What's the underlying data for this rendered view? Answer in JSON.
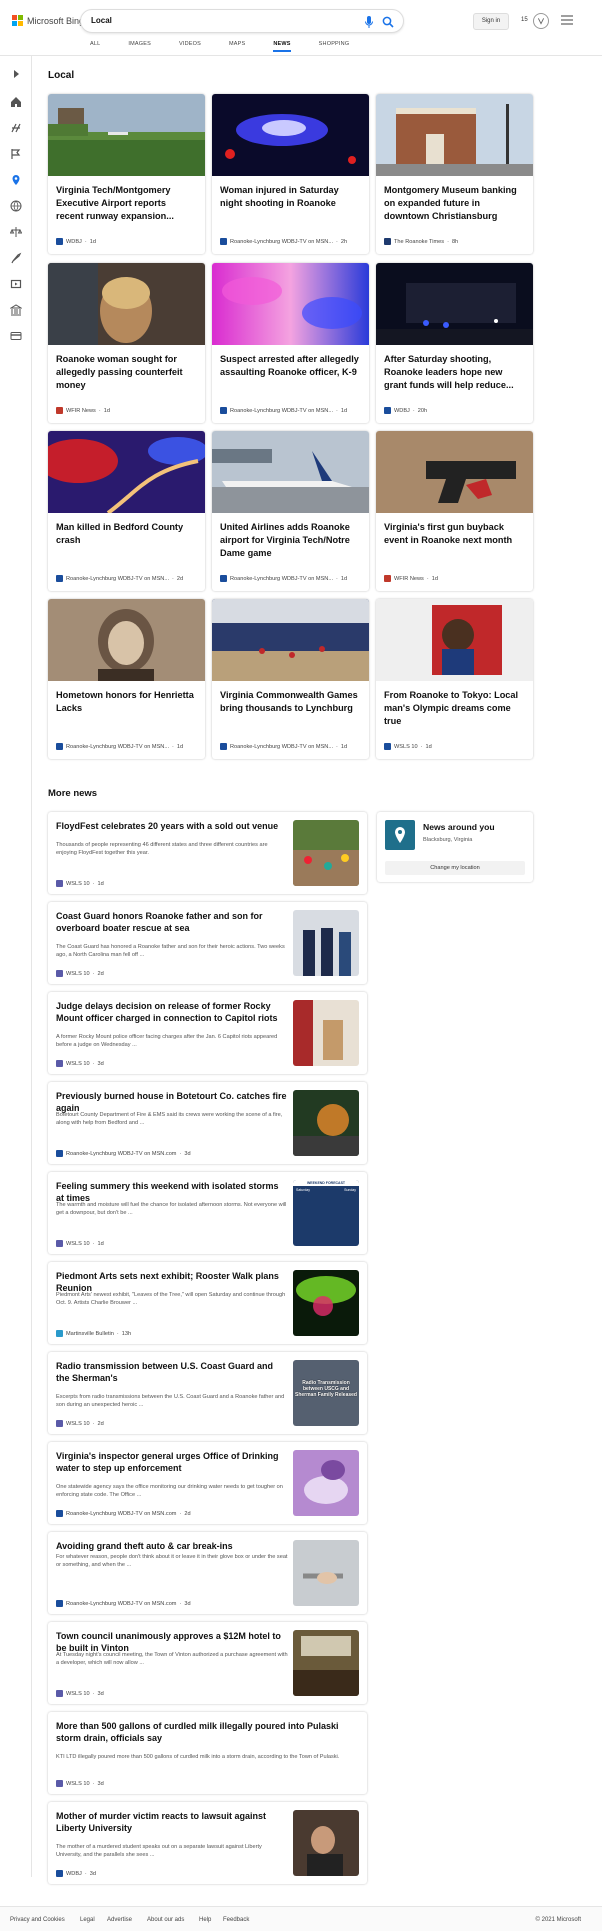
{
  "header": {
    "logo_text": "Microsoft Bing",
    "search_value": "Local",
    "signin_label": "Sign in",
    "points": "15",
    "tabs": [
      "ALL",
      "IMAGES",
      "VIDEOS",
      "MAPS",
      "NEWS",
      "SHOPPING"
    ],
    "active_tab": "NEWS"
  },
  "local": {
    "title": "Local",
    "cards": [
      {
        "title": "Virginia Tech/Montgomery Executive Airport reports recent runway expansion...",
        "source": "WDBJ",
        "time": "1d"
      },
      {
        "title": "Woman injured in Saturday night shooting in Roanoke",
        "source": "Roanoke-Lynchburg WDBJ-TV on MSN...",
        "time": "2h"
      },
      {
        "title": "Montgomery Museum banking on expanded future in downtown Christiansburg",
        "source": "The Roanoke Times",
        "time": "8h"
      },
      {
        "title": "Roanoke woman sought for allegedly passing counterfeit money",
        "source": "WFIR News",
        "time": "1d"
      },
      {
        "title": "Suspect arrested after allegedly assaulting Roanoke officer, K-9",
        "source": "Roanoke-Lynchburg WDBJ-TV on MSN...",
        "time": "1d"
      },
      {
        "title": "After Saturday shooting, Roanoke leaders hope new grant funds will help reduce...",
        "source": "WDBJ",
        "time": "20h"
      },
      {
        "title": "Man killed in Bedford County crash",
        "source": "Roanoke-Lynchburg WDBJ-TV on MSN...",
        "time": "2d"
      },
      {
        "title": "United Airlines adds Roanoke airport for Virginia Tech/Notre Dame game",
        "source": "Roanoke-Lynchburg WDBJ-TV on MSN...",
        "time": "1d"
      },
      {
        "title": "Virginia's first gun buyback event in Roanoke next month",
        "source": "WFIR News",
        "time": "1d"
      },
      {
        "title": "Hometown honors for Henrietta Lacks",
        "source": "Roanoke-Lynchburg WDBJ-TV on MSN...",
        "time": "1d"
      },
      {
        "title": "Virginia Commonwealth Games bring thousands to Lynchburg",
        "source": "Roanoke-Lynchburg WDBJ-TV on MSN...",
        "time": "1d"
      },
      {
        "title": "From Roanoke to Tokyo: Local man's Olympic dreams come true",
        "source": "WSLS 10",
        "time": "1d"
      }
    ]
  },
  "more": {
    "title": "More news",
    "items": [
      {
        "title": "FloydFest celebrates 20 years with a sold out venue",
        "desc": "Thousands of people representing 46 different states and three different countries are enjoying FloydFest together this year.",
        "source": "WSLS 10",
        "time": "1d"
      },
      {
        "title": "Coast Guard honors Roanoke father and son for overboard boater rescue at sea",
        "desc": "The Coast Guard has honored a Roanoke father and son for their heroic actions. Two weeks ago, a North Carolina man fell off ...",
        "source": "WSLS 10",
        "time": "2d"
      },
      {
        "title": "Judge delays decision on release of former Rocky Mount officer charged in connection to Capitol riots",
        "desc": "A former Rocky Mount police officer facing charges after the Jan. 6 Capitol riots appeared before a judge on Wednesday ...",
        "source": "WSLS 10",
        "time": "3d"
      },
      {
        "title": "Previously burned house in Botetourt Co. catches fire again",
        "desc": "Botetourt County Department of Fire & EMS said its crews were working the scene of a fire, along with help from Bedford and ...",
        "source": "Roanoke-Lynchburg WDBJ-TV on MSN.com",
        "time": "3d"
      },
      {
        "title": "Feeling summery this weekend with isolated storms at times",
        "desc": "The warmth and moisture will fuel the chance for isolated afternoon storms. Not everyone will get a downpour, but don't be ...",
        "source": "WSLS 10",
        "time": "1d"
      },
      {
        "title": "Piedmont Arts sets next exhibit; Rooster Walk plans Reunion",
        "desc": "Piedmont Arts' newest exhibit, \"Leaves of the Tree,\" will open Saturday and continue through Oct. 9. Artists Charlie Brouwer ...",
        "source": "Martinsville Bulletin",
        "time": "13h"
      },
      {
        "title": "Radio transmission between U.S. Coast Guard and the Sherman's",
        "desc": "Excerpts from radio transmissions between the U.S. Coast Guard and a Roanoke father and son during an unexpected heroic ...",
        "source": "WSLS 10",
        "time": "2d"
      },
      {
        "title": "Virginia's inspector general urges Office of Drinking water to step up enforcement",
        "desc": "One statewide agency says the office monitoring our drinking water needs to get tougher on enforcing state code. The Office ...",
        "source": "Roanoke-Lynchburg WDBJ-TV on MSN.com",
        "time": "2d"
      },
      {
        "title": "Avoiding grand theft auto & car break-ins",
        "desc": "For whatever reason, people don't think about it or leave it in their glove box or under the seat or something, and when the ...",
        "source": "Roanoke-Lynchburg WDBJ-TV on MSN.com",
        "time": "3d"
      },
      {
        "title": "Town council unanimously approves a $12M hotel to be built in Vinton",
        "desc": "At Tuesday night's council meeting, the Town of Vinton authorized a purchase agreement with a developer, which will now allow ...",
        "source": "WSLS 10",
        "time": "3d"
      },
      {
        "title": "More than 500 gallons of curdled milk illegally poured into Pulaski storm drain, officials say",
        "desc": "KTI LTD illegally poured more than 500 gallons of curdled milk into a storm drain, according to the Town of Pulaski.",
        "source": "WSLS 10",
        "time": "3d"
      },
      {
        "title": "Mother of murder victim reacts to lawsuit against Liberty University",
        "desc": "The mother of a murdered student speaks out on a separate lawsuit against Liberty University, and the parallels she sees ...",
        "source": "WDBJ",
        "time": "3d"
      }
    ]
  },
  "around": {
    "title": "News around you",
    "location": "Blacksburg, Virginia",
    "button": "Change my location"
  },
  "weather_thumb": {
    "title": "WEEKEND FORECAST",
    "days": [
      "Saturday",
      "Sunday"
    ]
  },
  "radio_thumb_text": "Radio Transmission between USCG and Sherman Family Released",
  "footer": {
    "links": [
      "Privacy and Cookies",
      "Legal",
      "Advertise",
      "About our ads",
      "Help",
      "Feedback"
    ],
    "copyright": "© 2021 Microsoft"
  },
  "colors": {
    "accent": "#1a73e8",
    "pin": "#1f6f8b"
  },
  "icons": [
    "search-icon",
    "microphone-icon",
    "rewards-icon",
    "menu-icon",
    "expand-icon",
    "home-icon",
    "sports-icon",
    "flag-icon",
    "location-icon",
    "globe-icon",
    "scale-icon",
    "rocket-icon",
    "entertainment-icon",
    "money-icon",
    "card-icon"
  ]
}
